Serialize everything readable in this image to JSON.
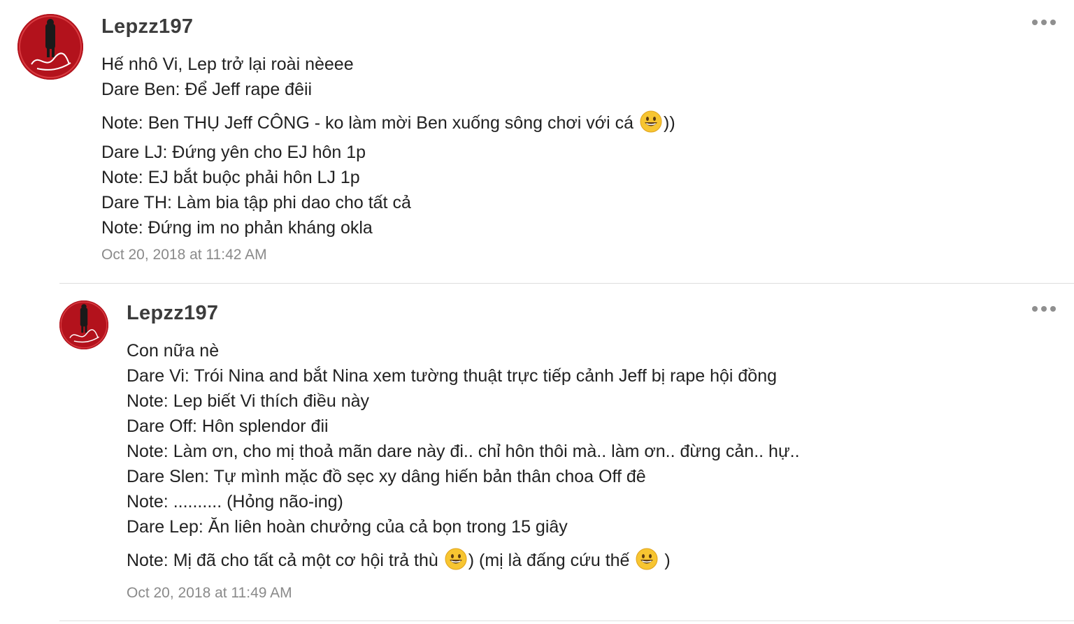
{
  "comments": [
    {
      "username": "Lepzz197",
      "lines": [
        "Hế nhô Vi, Lep trở lại roài nèeee",
        "Dare Ben: Để Jeff rape đêii",
        "Note: Ben THỤ Jeff CÔNG - ko làm mời Ben xuống sông chơi với cá ",
        "))",
        "Dare LJ: Đứng yên cho EJ hôn 1p",
        "Note: EJ bắt buộc phải hôn LJ 1p",
        "Dare TH: Làm bia tập phi dao cho tất cả",
        "Note: Đứng im no phản kháng okla"
      ],
      "timestamp": "Oct 20, 2018 at 11:42 AM"
    },
    {
      "username": "Lepzz197",
      "lines": [
        "Con nữa nè",
        "Dare Vi: Trói Nina and bắt Nina xem tường thuật trực tiếp cảnh Jeff bị rape hội đồng",
        "Note: Lep biết Vi thích điều này",
        "Dare Off: Hôn splendor đii",
        "Note: Làm ơn, cho mị thoả mãn dare này đi.. chỉ hôn thôi mà.. làm ơn.. đừng cản.. hự..",
        "Dare Slen: Tự mình mặc đồ sẹc xy dâng hiến bản thân choa Off đê",
        "Note: .......... (Hỏng não-ing)",
        "Dare Lep: Ăn liên hoàn chưởng của cả bọn trong 15 giây",
        "Note: Mị đã cho tất cả một cơ hội trả thù ",
        ") (mị là đấng cứu thế ",
        " )"
      ],
      "timestamp": "Oct 20, 2018 at 11:49 AM"
    }
  ],
  "icons": {
    "more": "more-options-icon",
    "emoji": "grinning-face-emoji"
  },
  "colors": {
    "username": "#3c3c3c",
    "text": "#222222",
    "timestamp": "#8a8a8a",
    "divider": "#dedede",
    "avatar_red": "#b3121c",
    "emoji_yellow": "#f7c531"
  }
}
